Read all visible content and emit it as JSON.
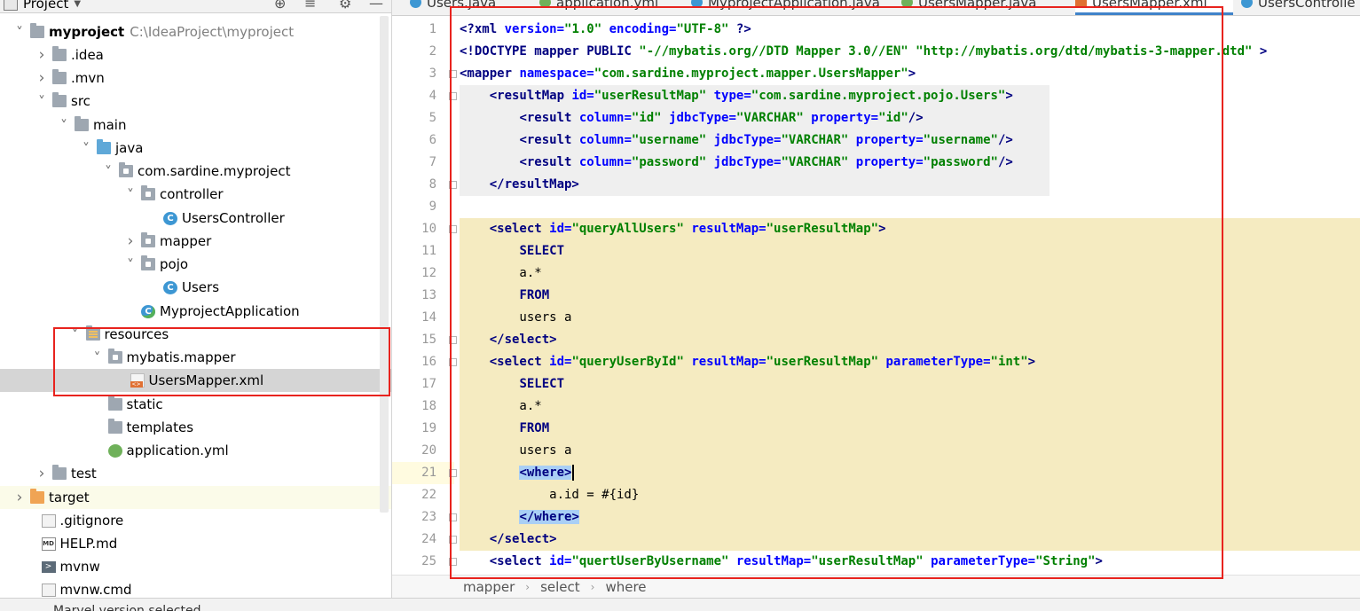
{
  "panel": {
    "title": "Project"
  },
  "tree": [
    {
      "label": "myproject",
      "hint": "C:\\IdeaProject\\myproject",
      "icon": "folder-module",
      "state": "open"
    },
    {
      "label": ".idea",
      "icon": "folder",
      "state": "closed"
    },
    {
      "label": ".mvn",
      "icon": "folder",
      "state": "closed"
    },
    {
      "label": "src",
      "icon": "folder",
      "state": "open"
    },
    {
      "label": "main",
      "icon": "folder",
      "state": "open"
    },
    {
      "label": "java",
      "icon": "folder-source",
      "state": "open"
    },
    {
      "label": "com.sardine.myproject",
      "icon": "package",
      "state": "open"
    },
    {
      "label": "controller",
      "icon": "package",
      "state": "open"
    },
    {
      "label": "UsersController",
      "icon": "class",
      "state": "leaf"
    },
    {
      "label": "mapper",
      "icon": "package",
      "state": "closed"
    },
    {
      "label": "pojo",
      "icon": "package",
      "state": "open"
    },
    {
      "label": "Users",
      "icon": "class",
      "state": "leaf"
    },
    {
      "label": "MyprojectApplication",
      "icon": "spring-app",
      "state": "leaf"
    },
    {
      "label": "resources",
      "icon": "folder-resources",
      "state": "open"
    },
    {
      "label": "mybatis.mapper",
      "icon": "package",
      "state": "open"
    },
    {
      "label": "UsersMapper.xml",
      "icon": "xml-file",
      "state": "leaf",
      "selected": true
    },
    {
      "label": "static",
      "icon": "folder",
      "state": "leaf"
    },
    {
      "label": "templates",
      "icon": "folder",
      "state": "leaf"
    },
    {
      "label": "application.yml",
      "icon": "yaml-file",
      "state": "leaf"
    },
    {
      "label": "test",
      "icon": "folder",
      "state": "closed"
    },
    {
      "label": "target",
      "icon": "folder-excluded",
      "state": "closed"
    },
    {
      "label": ".gitignore",
      "icon": "text-file",
      "state": "leaf"
    },
    {
      "label": "HELP.md",
      "icon": "markdown-file",
      "state": "leaf"
    },
    {
      "label": "mvnw",
      "icon": "script-file",
      "state": "leaf"
    },
    {
      "label": "mvnw.cmd",
      "icon": "text-file",
      "state": "leaf"
    }
  ],
  "tabs": [
    {
      "label": "Users.java",
      "icon": "class"
    },
    {
      "label": "application.yml",
      "icon": "yaml-file"
    },
    {
      "label": "MyprojectApplication.java",
      "icon": "class"
    },
    {
      "label": "UsersMapper.java",
      "icon": "interface"
    },
    {
      "label": "UsersMapper.xml",
      "icon": "xml-file",
      "active": true
    },
    {
      "label": "UsersControlle",
      "icon": "class"
    }
  ],
  "code": {
    "line_numbers": [
      "1",
      "2",
      "3",
      "4",
      "5",
      "6",
      "7",
      "8",
      "9",
      "10",
      "11",
      "12",
      "13",
      "14",
      "15",
      "16",
      "17",
      "18",
      "19",
      "20",
      "21",
      "22",
      "23",
      "24",
      "25"
    ],
    "lines": [
      {
        "seg": [
          [
            "t",
            "<?xml "
          ],
          [
            "a",
            "version="
          ],
          [
            "v",
            "\"1.0\""
          ],
          [
            "p",
            " "
          ],
          [
            "a",
            "encoding="
          ],
          [
            "v",
            "\"UTF-8\""
          ],
          [
            "p",
            " "
          ],
          [
            "t",
            "?>"
          ]
        ]
      },
      {
        "seg": [
          [
            "t",
            "<!DOCTYPE mapper PUBLIC "
          ],
          [
            "v",
            "\"-//mybatis.org//DTD Mapper 3.0//EN\""
          ],
          [
            "p",
            " "
          ],
          [
            "v",
            "\"http://mybatis.org/dtd/mybatis-3-mapper.dtd\""
          ],
          [
            "p",
            " "
          ],
          [
            "t",
            ">"
          ]
        ]
      },
      {
        "seg": [
          [
            "t",
            "<mapper "
          ],
          [
            "a",
            "namespace="
          ],
          [
            "v",
            "\"com.sardine.myproject.mapper.UsersMapper\""
          ],
          [
            "t",
            ">"
          ]
        ]
      },
      {
        "seg": [
          [
            "p",
            "    "
          ],
          [
            "t",
            "<resultMap "
          ],
          [
            "a",
            "id="
          ],
          [
            "v",
            "\"userResultMap\""
          ],
          [
            "p",
            " "
          ],
          [
            "a",
            "type="
          ],
          [
            "v",
            "\"com.sardine.myproject.pojo.Users\""
          ],
          [
            "t",
            ">"
          ]
        ]
      },
      {
        "seg": [
          [
            "p",
            "        "
          ],
          [
            "t",
            "<result "
          ],
          [
            "a",
            "column="
          ],
          [
            "v",
            "\"id\""
          ],
          [
            "p",
            " "
          ],
          [
            "a",
            "jdbcType="
          ],
          [
            "v",
            "\"VARCHAR\""
          ],
          [
            "p",
            " "
          ],
          [
            "a",
            "property="
          ],
          [
            "v",
            "\"id\""
          ],
          [
            "t",
            "/>"
          ]
        ]
      },
      {
        "seg": [
          [
            "p",
            "        "
          ],
          [
            "t",
            "<result "
          ],
          [
            "a",
            "column="
          ],
          [
            "v",
            "\"username\""
          ],
          [
            "p",
            " "
          ],
          [
            "a",
            "jdbcType="
          ],
          [
            "v",
            "\"VARCHAR\""
          ],
          [
            "p",
            " "
          ],
          [
            "a",
            "property="
          ],
          [
            "v",
            "\"username\""
          ],
          [
            "t",
            "/>"
          ]
        ]
      },
      {
        "seg": [
          [
            "p",
            "        "
          ],
          [
            "t",
            "<result "
          ],
          [
            "a",
            "column="
          ],
          [
            "v",
            "\"password\""
          ],
          [
            "p",
            " "
          ],
          [
            "a",
            "jdbcType="
          ],
          [
            "v",
            "\"VARCHAR\""
          ],
          [
            "p",
            " "
          ],
          [
            "a",
            "property="
          ],
          [
            "v",
            "\"password\""
          ],
          [
            "t",
            "/>"
          ]
        ]
      },
      {
        "seg": [
          [
            "p",
            "    "
          ],
          [
            "t",
            "</resultMap>"
          ]
        ]
      },
      {
        "seg": [
          [
            "p",
            ""
          ]
        ]
      },
      {
        "seg": [
          [
            "p",
            "    "
          ],
          [
            "t",
            "<select "
          ],
          [
            "a",
            "id="
          ],
          [
            "v",
            "\"queryAllUsers\""
          ],
          [
            "p",
            " "
          ],
          [
            "a",
            "resultMap="
          ],
          [
            "v",
            "\"userResultMap\""
          ],
          [
            "t",
            ">"
          ]
        ]
      },
      {
        "seg": [
          [
            "p",
            "        "
          ],
          [
            "kw",
            "SELECT"
          ]
        ]
      },
      {
        "seg": [
          [
            "p",
            "        a.*"
          ]
        ]
      },
      {
        "seg": [
          [
            "p",
            "        "
          ],
          [
            "kw",
            "FROM"
          ]
        ]
      },
      {
        "seg": [
          [
            "p",
            "        users a"
          ]
        ]
      },
      {
        "seg": [
          [
            "p",
            "    "
          ],
          [
            "t",
            "</select>"
          ]
        ]
      },
      {
        "seg": [
          [
            "p",
            "    "
          ],
          [
            "t",
            "<select "
          ],
          [
            "a",
            "id="
          ],
          [
            "v",
            "\"queryUserById\""
          ],
          [
            "p",
            " "
          ],
          [
            "a",
            "resultMap="
          ],
          [
            "v",
            "\"userResultMap\""
          ],
          [
            "p",
            " "
          ],
          [
            "a",
            "parameterType="
          ],
          [
            "v",
            "\"int\""
          ],
          [
            "t",
            ">"
          ]
        ]
      },
      {
        "seg": [
          [
            "p",
            "        "
          ],
          [
            "kw",
            "SELECT"
          ]
        ]
      },
      {
        "seg": [
          [
            "p",
            "        a.*"
          ]
        ]
      },
      {
        "seg": [
          [
            "p",
            "        "
          ],
          [
            "kw",
            "FROM"
          ]
        ]
      },
      {
        "seg": [
          [
            "p",
            "        users a"
          ]
        ]
      },
      {
        "seg": [
          [
            "p",
            "        "
          ],
          [
            "hl",
            "<where>"
          ]
        ]
      },
      {
        "seg": [
          [
            "p",
            "            a.id = #{id}"
          ]
        ]
      },
      {
        "seg": [
          [
            "p",
            "        "
          ],
          [
            "hl",
            "</where>"
          ]
        ]
      },
      {
        "seg": [
          [
            "p",
            "    "
          ],
          [
            "t",
            "</select>"
          ]
        ]
      },
      {
        "seg": [
          [
            "p",
            "    "
          ],
          [
            "t",
            "<select "
          ],
          [
            "a",
            "id="
          ],
          [
            "v",
            "\"quertUserByUsername\""
          ],
          [
            "p",
            " "
          ],
          [
            "a",
            "resultMap="
          ],
          [
            "v",
            "\"userResultMap\""
          ],
          [
            "p",
            " "
          ],
          [
            "a",
            "parameterType="
          ],
          [
            "v",
            "\"String\""
          ],
          [
            "t",
            ">"
          ]
        ]
      }
    ]
  },
  "breadcrumb": [
    "mapper",
    "select",
    "where"
  ],
  "bottom": {
    "label": "Marvel version selected"
  },
  "colors": {
    "annotation": "#e8231e",
    "tag": "#000080",
    "attribute": "#0000ff",
    "value": "#008000",
    "selection_block": "#f5ebc1",
    "tab_active_border": "#4083c9"
  }
}
